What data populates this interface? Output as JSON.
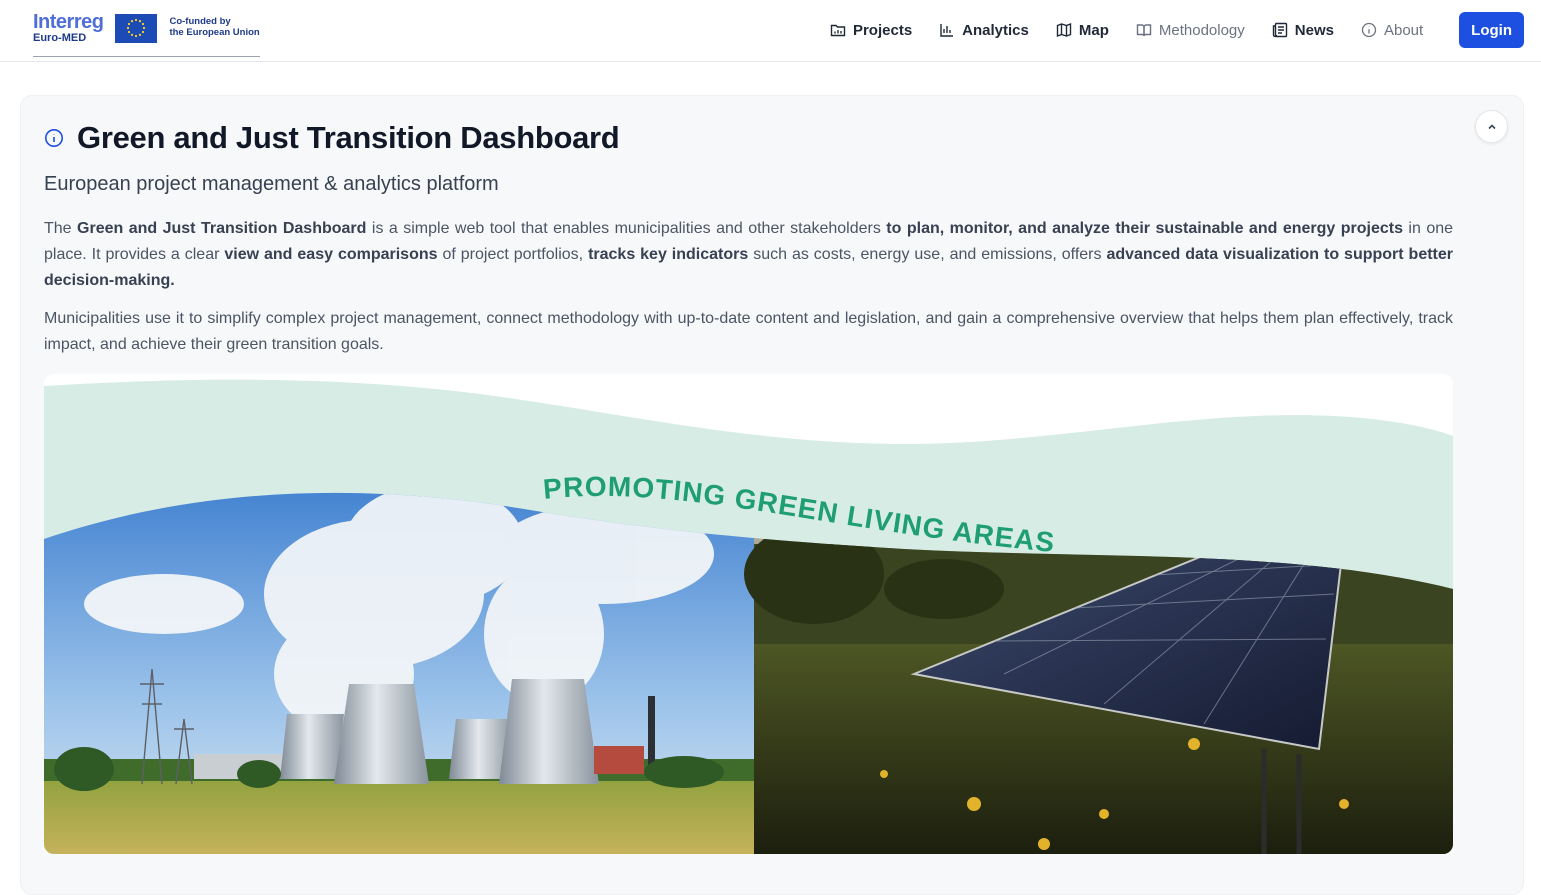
{
  "brand": {
    "program_name": "Interreg",
    "program_sub": "Euro-MED",
    "cofund_line1": "Co-funded by",
    "cofund_line2": "the European Union"
  },
  "nav": {
    "items": [
      {
        "label": "Projects",
        "icon": "folder-icon",
        "active": true
      },
      {
        "label": "Analytics",
        "icon": "bar-chart-icon",
        "active": true
      },
      {
        "label": "Map",
        "icon": "map-icon",
        "active": true
      },
      {
        "label": "Methodology",
        "icon": "book-icon",
        "active": false
      },
      {
        "label": "News",
        "icon": "newspaper-icon",
        "active": true
      },
      {
        "label": "About",
        "icon": "info-icon",
        "active": false
      }
    ],
    "login_label": "Login"
  },
  "intro": {
    "title": "Green and Just Transition Dashboard",
    "subtitle": "European project management & analytics platform",
    "p1": {
      "t1": "The ",
      "b1": "Green and Just Transition Dashboard",
      "t2": " is a simple web tool that enables municipalities and other stakeholders ",
      "b2": "to plan, monitor, and analyze their sustainable and energy projects",
      "t3": " in one place. It provides a clear ",
      "b3": "view and easy comparisons",
      "t4": " of project portfolios, ",
      "b4": "tracks key indicators",
      "t5": " such as costs, energy use, and emissions, offers ",
      "b5": "advanced data visualization to support better decision-making."
    },
    "p2": "Municipalities use it to simplify complex project management, connect methodology with up-to-date content and legislation, and gain a comprehensive overview that helps them plan effectively, track impact, and achieve their green transition goals.",
    "hero_caption": "PROMOTING GREEN LIVING AREAS"
  },
  "colors": {
    "accent": "#1d4fe0",
    "brand_blue": "#4f6fd6",
    "eu_blue": "#1d4bb5",
    "caption_green": "#1f9e74",
    "card_bg": "#f7f8fa"
  }
}
